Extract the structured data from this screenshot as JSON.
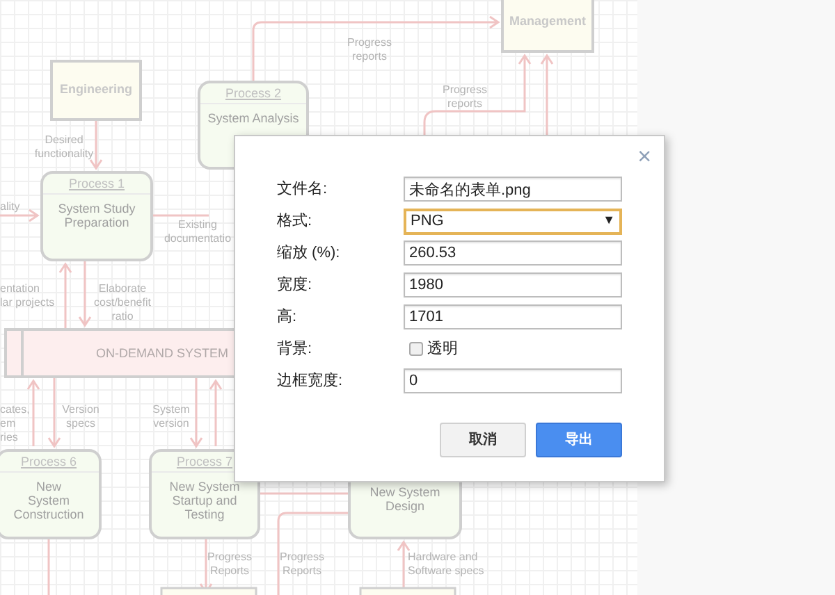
{
  "diagram": {
    "nodes": [
      {
        "kind": "entity",
        "label": "Management"
      },
      {
        "kind": "entity",
        "label": "Engineering"
      },
      {
        "kind": "process",
        "header": "Process 2",
        "label": "System Analysis"
      },
      {
        "kind": "process",
        "header": "Process 1",
        "label": "System Study\nPreparation"
      },
      {
        "kind": "store",
        "label": "ON-DEMAND SYSTEM"
      },
      {
        "kind": "process",
        "header": "Process 6",
        "label": "New\nSystem\nConstruction"
      },
      {
        "kind": "process",
        "header": "Process 7",
        "label": "New System\nStartup and\nTesting"
      },
      {
        "kind": "process",
        "label": "New System\nDesign"
      }
    ],
    "edge_labels": [
      "Progress\nreports",
      "Progress\nreports",
      "Desired\nfunctionality",
      "ality",
      "Existing\ndocumentatio",
      "entation\nlar projects",
      "Elaborate\ncost/benefit\nratio",
      "cates,\nem\nries",
      "Version\nspecs",
      "System\nversion",
      "Progress\nReports",
      "Progress\nReports",
      "Hardware and\nSoftware specs"
    ]
  },
  "dialog": {
    "close": "×",
    "fields": [
      {
        "kind": "text",
        "label": "文件名:",
        "value": "未命名的表单.png"
      },
      {
        "kind": "select",
        "label": "格式:",
        "value": "PNG",
        "arrow": "▼",
        "focused": true
      },
      {
        "kind": "text",
        "label": "缩放 (%):",
        "value": "260.53"
      },
      {
        "kind": "text",
        "label": "宽度:",
        "value": "1980"
      },
      {
        "kind": "text",
        "label": "高:",
        "value": "1701"
      },
      {
        "kind": "checkbox",
        "label": "背景:",
        "option": "透明",
        "checked": false
      },
      {
        "kind": "text",
        "label": "边框宽度:",
        "value": "0"
      }
    ],
    "buttons": [
      {
        "label": "取消",
        "primary": false
      },
      {
        "label": "导出",
        "primary": true
      }
    ]
  }
}
